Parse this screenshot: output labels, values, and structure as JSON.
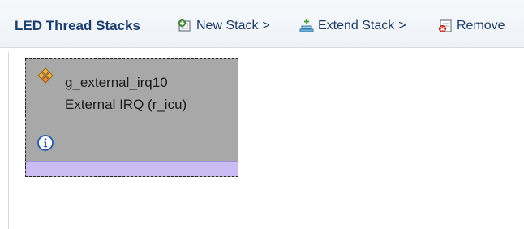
{
  "panel": {
    "title": "LED Thread Stacks"
  },
  "toolbar": {
    "new_stack": {
      "label": "New Stack",
      "separator": ">",
      "icon": "new-stack-icon"
    },
    "extend_stack": {
      "label": "Extend Stack",
      "separator": ">",
      "icon": "extend-stack-icon"
    },
    "remove": {
      "label": "Remove",
      "icon": "remove-icon"
    }
  },
  "thread_card": {
    "name": "g_external_irq10",
    "description": "External IRQ (r_icu)",
    "icon": "module-icon",
    "info_icon": "info-icon",
    "background_color": "#a8a8a8",
    "footer_color": "#cbbcf4"
  }
}
